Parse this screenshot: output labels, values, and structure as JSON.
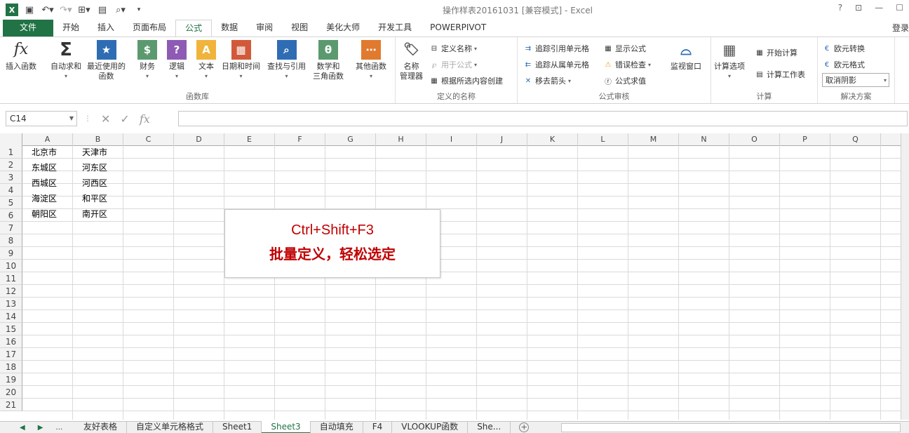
{
  "window": {
    "title": "操作样表20161031  [兼容模式] - Excel",
    "help": "?",
    "login": "登录"
  },
  "tabs": [
    {
      "label": "文件"
    },
    {
      "label": "开始"
    },
    {
      "label": "插入"
    },
    {
      "label": "页面布局"
    },
    {
      "label": "公式"
    },
    {
      "label": "数据"
    },
    {
      "label": "审阅"
    },
    {
      "label": "视图"
    },
    {
      "label": "美化大师"
    },
    {
      "label": "开发工具"
    },
    {
      "label": "POWERPIVOT"
    }
  ],
  "ribbon": {
    "insert_function": "插入函数",
    "autosum": "自动求和",
    "recent": "最近使用的\n函数",
    "finance": "财务",
    "logic": "逻辑",
    "text": "文本",
    "datetime": "日期和时间",
    "lookup": "查找与引用",
    "math": "数学和\n三角函数",
    "other": "其他函数",
    "group_lib": "函数库",
    "name_manager": "名称\n管理器",
    "define_name": "定义名称",
    "use_in_formula": "用于公式",
    "create_from_sel": "根据所选内容创建",
    "group_names": "定义的名称",
    "trace_precedents": "追踪引用单元格",
    "trace_dependents": "追踪从属单元格",
    "remove_arrows": "移去箭头",
    "show_formulas": "显示公式",
    "error_check": "错误检查",
    "eval_formula": "公式求值",
    "watch": "监视窗口",
    "group_audit": "公式审核",
    "calc_options": "计算选项",
    "calc_now": "开始计算",
    "calc_sheet": "计算工作表",
    "group_calc": "计算",
    "euro_convert": "欧元转换",
    "euro_format": "欧元格式",
    "cancel_shade": "取消阴影",
    "group_solutions": "解决方案"
  },
  "namebox": "C14",
  "columns": [
    "A",
    "B",
    "C",
    "D",
    "E",
    "F",
    "G",
    "H",
    "I",
    "J",
    "K",
    "L",
    "M",
    "N",
    "O",
    "P",
    "Q"
  ],
  "rows": [
    "1",
    "2",
    "3",
    "4",
    "5",
    "6",
    "7",
    "8",
    "9",
    "10",
    "11",
    "12",
    "13",
    "14",
    "15",
    "16",
    "17",
    "18",
    "19",
    "20",
    "21"
  ],
  "cells": {
    "A": [
      "北京市",
      "东城区",
      "西城区",
      "海淀区",
      "朝阳区"
    ],
    "B": [
      "天津市",
      "河东区",
      "河西区",
      "和平区",
      "南开区"
    ]
  },
  "callout": {
    "line1": "Ctrl+Shift+F3",
    "line2": "批量定义，轻松选定"
  },
  "sheets": [
    "友好表格",
    "自定义单元格格式",
    "Sheet1",
    "Sheet3",
    "自动填充",
    "F4",
    "VLOOKUP函数",
    "She..."
  ],
  "active_sheet": "Sheet3",
  "colors": {
    "accent": "#217346",
    "callout_text": "#c00000"
  }
}
